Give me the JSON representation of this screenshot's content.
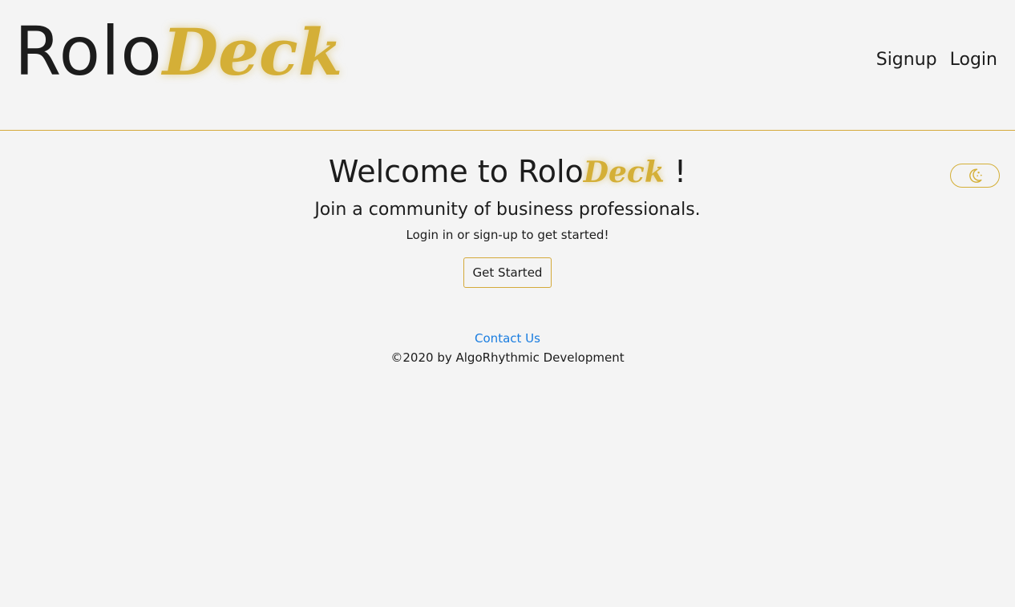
{
  "header": {
    "logo": {
      "part1": "Rolo",
      "part2": "Deck"
    },
    "nav": [
      {
        "label": "Signup"
      },
      {
        "label": "Login"
      }
    ]
  },
  "theme_toggle": {
    "icon": "moon-stars-icon"
  },
  "main": {
    "welcome_prefix": "Welcome to Rolo",
    "welcome_brand": "Deck",
    "welcome_suffix": " !",
    "subtitle": "Join a community of business professionals.",
    "tagline": "Login in or sign-up to get started!",
    "cta_label": "Get Started"
  },
  "footer": {
    "contact_label": "Contact Us",
    "copyright": "©2020 by AlgoRhythmic Development"
  },
  "colors": {
    "background": "#f4f4f4",
    "text": "#1c1c1c",
    "accent_gold": "#d4af37",
    "link_blue": "#1a7de0"
  }
}
